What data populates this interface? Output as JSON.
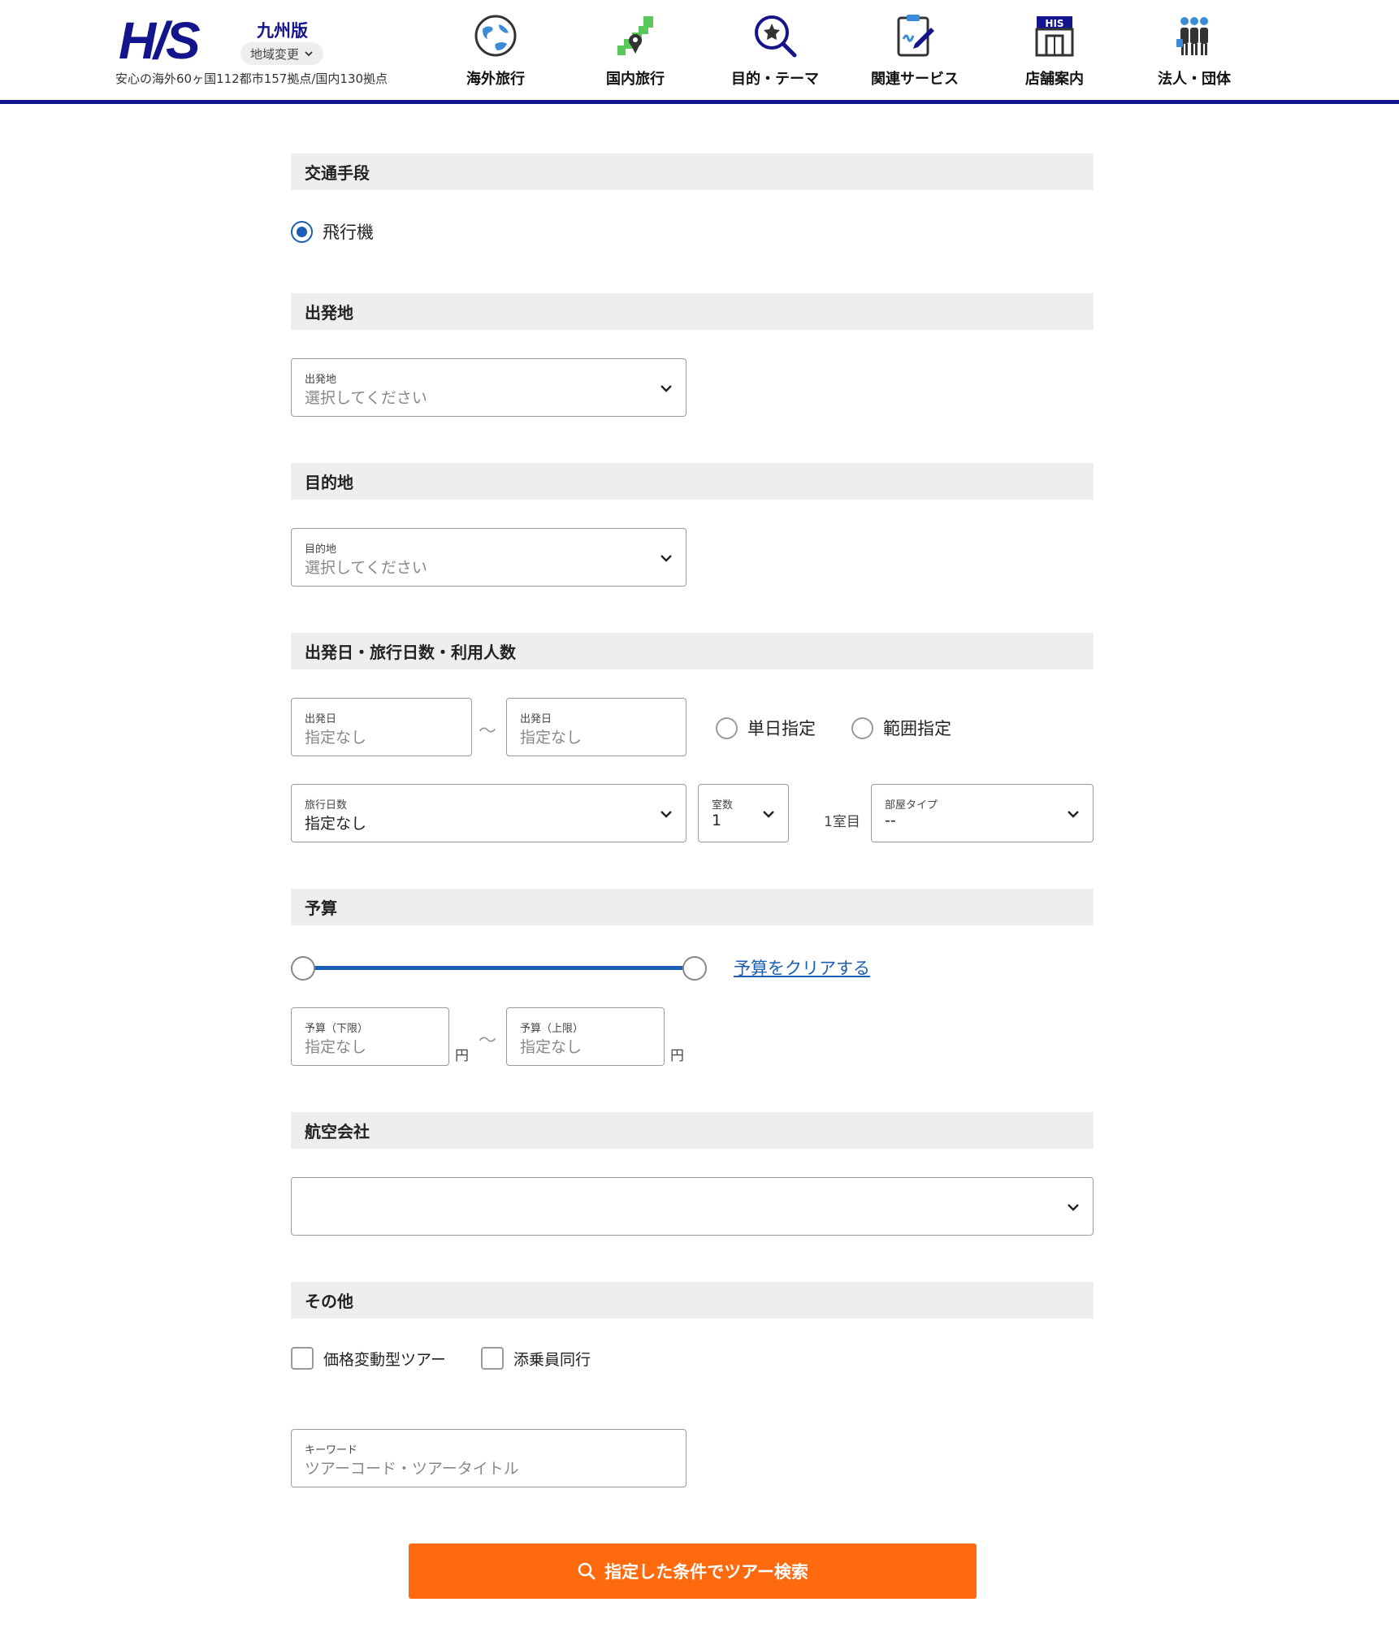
{
  "header": {
    "logo_text": "H/S",
    "region_name": "九州版",
    "region_change_label": "地域変更",
    "tagline": "安心の海外60ヶ国112都市157拠点/国内130拠点",
    "nav": [
      {
        "label": "海外旅行",
        "icon": "globe-icon"
      },
      {
        "label": "国内旅行",
        "icon": "japan-map-icon"
      },
      {
        "label": "目的・テーマ",
        "icon": "magnifier-star-icon"
      },
      {
        "label": "関連サービス",
        "icon": "clipboard-pen-icon"
      },
      {
        "label": "店舗案内",
        "icon": "store-icon"
      },
      {
        "label": "法人・団体",
        "icon": "people-group-icon"
      }
    ],
    "store_badge": "HIS",
    "accent_color": "#14148c"
  },
  "sections": {
    "transport": {
      "title": "交通手段",
      "option_label": "飛行機",
      "option_checked": true
    },
    "departure": {
      "title": "出発地",
      "field_label": "出発地",
      "field_value": "選択してください"
    },
    "destination": {
      "title": "目的地",
      "field_label": "目的地",
      "field_value": "選択してください"
    },
    "dates": {
      "title": "出発日・旅行日数・利用人数",
      "date_from_label": "出発日",
      "date_from_value": "指定なし",
      "tilde": "～",
      "date_to_label": "出発日",
      "date_to_value": "指定なし",
      "single_day_label": "単日指定",
      "range_label": "範囲指定",
      "days_label": "旅行日数",
      "days_value": "指定なし",
      "rooms_label": "室数",
      "rooms_value": "1",
      "room_index_label": "1室目",
      "room_type_label": "部屋タイプ",
      "room_type_value": "--"
    },
    "budget": {
      "title": "予算",
      "clear_label": "予算をクリアする",
      "min_label": "予算（下限）",
      "min_value": "指定なし",
      "max_label": "予算（上限）",
      "max_value": "指定なし",
      "yen": "円",
      "tilde": "～"
    },
    "airline": {
      "title": "航空会社",
      "value": ""
    },
    "other": {
      "title": "その他",
      "checkbox1_label": "価格変動型ツアー",
      "checkbox2_label": "添乗員同行",
      "keyword_label": "キーワード",
      "keyword_placeholder": "ツアーコード・ツアータイトル"
    }
  },
  "search_button_label": "指定した条件でツアー検索",
  "colors": {
    "button": "#ff6a0f",
    "link": "#1a5fb4",
    "section_bg": "#eeeeee"
  }
}
